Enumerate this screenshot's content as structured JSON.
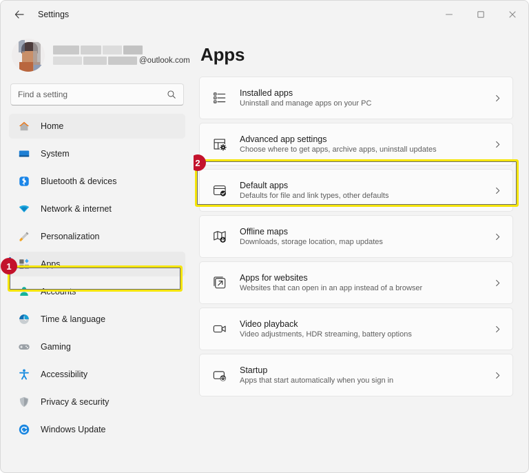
{
  "window": {
    "title": "Settings",
    "back_icon": "back-arrow-icon",
    "controls": {
      "minimize": "minimize-icon",
      "maximize": "maximize-icon",
      "close": "close-icon"
    }
  },
  "profile": {
    "avatar": "user-avatar-photo",
    "name_redacted": true,
    "email_visible": "@outlook.com"
  },
  "search": {
    "placeholder": "Find a setting",
    "value": "",
    "icon": "search-icon"
  },
  "sidebar": {
    "items": [
      {
        "label": "Home",
        "icon": "home-icon",
        "state": "hovered"
      },
      {
        "label": "System",
        "icon": "system-monitor-icon",
        "state": "normal"
      },
      {
        "label": "Bluetooth & devices",
        "icon": "bluetooth-icon",
        "state": "normal"
      },
      {
        "label": "Network & internet",
        "icon": "wifi-icon",
        "state": "normal"
      },
      {
        "label": "Personalization",
        "icon": "paintbrush-icon",
        "state": "normal"
      },
      {
        "label": "Apps",
        "icon": "apps-icon",
        "state": "selected"
      },
      {
        "label": "Accounts",
        "icon": "account-person-icon",
        "state": "normal"
      },
      {
        "label": "Time & language",
        "icon": "clock-icon",
        "state": "normal"
      },
      {
        "label": "Gaming",
        "icon": "gamepad-icon",
        "state": "normal"
      },
      {
        "label": "Accessibility",
        "icon": "accessibility-icon",
        "state": "normal"
      },
      {
        "label": "Privacy & security",
        "icon": "shield-icon",
        "state": "normal"
      },
      {
        "label": "Windows Update",
        "icon": "update-refresh-icon",
        "state": "normal"
      }
    ]
  },
  "main": {
    "title": "Apps",
    "cards": [
      {
        "title": "Installed apps",
        "sub": "Uninstall and manage apps on your PC",
        "icon": "list-icon",
        "highlighted": false
      },
      {
        "title": "Advanced app settings",
        "sub": "Choose where to get apps, archive apps, uninstall updates",
        "icon": "window-gear-icon",
        "highlighted": false
      },
      {
        "title": "Default apps",
        "sub": "Defaults for file and link types, other defaults",
        "icon": "default-apps-check-icon",
        "highlighted": true
      },
      {
        "title": "Offline maps",
        "sub": "Downloads, storage location, map updates",
        "icon": "map-download-icon",
        "highlighted": false
      },
      {
        "title": "Apps for websites",
        "sub": "Websites that can open in an app instead of a browser",
        "icon": "external-link-icon",
        "highlighted": false
      },
      {
        "title": "Video playback",
        "sub": "Video adjustments, HDR streaming, battery options",
        "icon": "video-camera-icon",
        "highlighted": false
      },
      {
        "title": "Startup",
        "sub": "Apps that start automatically when you sign in",
        "icon": "startup-power-icon",
        "highlighted": false
      }
    ]
  },
  "annotations": {
    "step1": {
      "label": "1",
      "target": "sidebar-item-apps"
    },
    "step2": {
      "label": "2",
      "target": "card-default-apps"
    },
    "highlight_color": "#f5e50a",
    "badge_color": "#c3122c"
  }
}
